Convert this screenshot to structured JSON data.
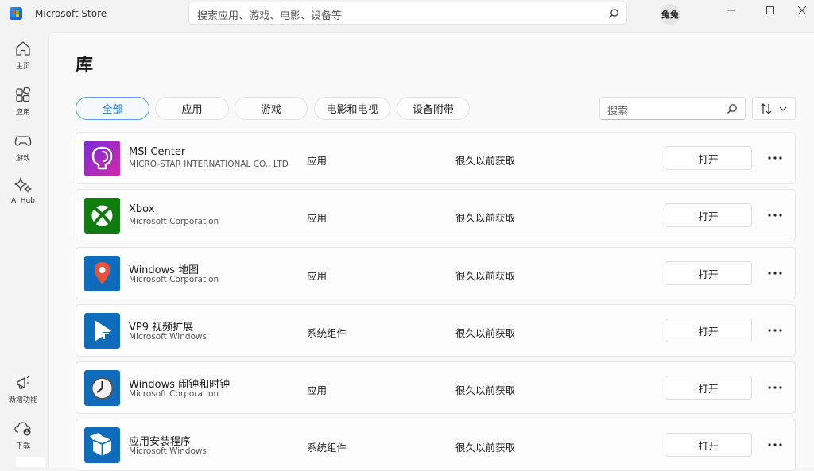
{
  "window": {
    "title": "Microsoft Store"
  },
  "search": {
    "placeholder": "搜索应用、游戏、电影、设备等"
  },
  "user": {
    "avatar_text": "兔兔"
  },
  "nav": {
    "items": [
      {
        "label": "主页",
        "icon": "home-icon"
      },
      {
        "label": "应用",
        "icon": "apps-icon"
      },
      {
        "label": "游戏",
        "icon": "gamepad-icon"
      },
      {
        "label": "AI Hub",
        "icon": "sparkle-icon"
      }
    ],
    "bottom_items": [
      {
        "label": "新增功能",
        "icon": "megaphone-icon"
      },
      {
        "label": "下载",
        "icon": "cloud-download-icon"
      }
    ]
  },
  "library": {
    "title": "库",
    "filters": [
      "全部",
      "应用",
      "游戏",
      "电影和电视",
      "设备附带"
    ],
    "active_filter": "全部",
    "search_placeholder": "搜索",
    "items": [
      {
        "name": "MSI Center",
        "publisher": "MICRO-STAR INTERNATIONAL CO., LTD",
        "type": "应用",
        "acquired": "很久以前获取",
        "action": "打开",
        "icon": "msi-center-icon"
      },
      {
        "name": "Xbox",
        "publisher": "Microsoft Corporation",
        "type": "应用",
        "acquired": "很久以前获取",
        "action": "打开",
        "icon": "xbox-icon"
      },
      {
        "name": "Windows 地图",
        "publisher": "Microsoft Corporation",
        "type": "应用",
        "acquired": "很久以前获取",
        "action": "打开",
        "icon": "maps-icon"
      },
      {
        "name": "VP9 视频扩展",
        "publisher": "Microsoft Windows",
        "type": "系统组件",
        "acquired": "很久以前获取",
        "action": "打开",
        "icon": "video-extension-icon"
      },
      {
        "name": "Windows 闹钟和时钟",
        "publisher": "Microsoft Corporation",
        "type": "应用",
        "acquired": "很久以前获取",
        "action": "打开",
        "icon": "alarm-clock-icon"
      },
      {
        "name": "应用安装程序",
        "publisher": "Microsoft Windows",
        "type": "系统组件",
        "acquired": "很久以前获取",
        "action": "打开",
        "icon": "app-installer-icon"
      }
    ]
  },
  "colors": {
    "accent": "#0067c0",
    "active_chip_text": "#1a70c7"
  }
}
